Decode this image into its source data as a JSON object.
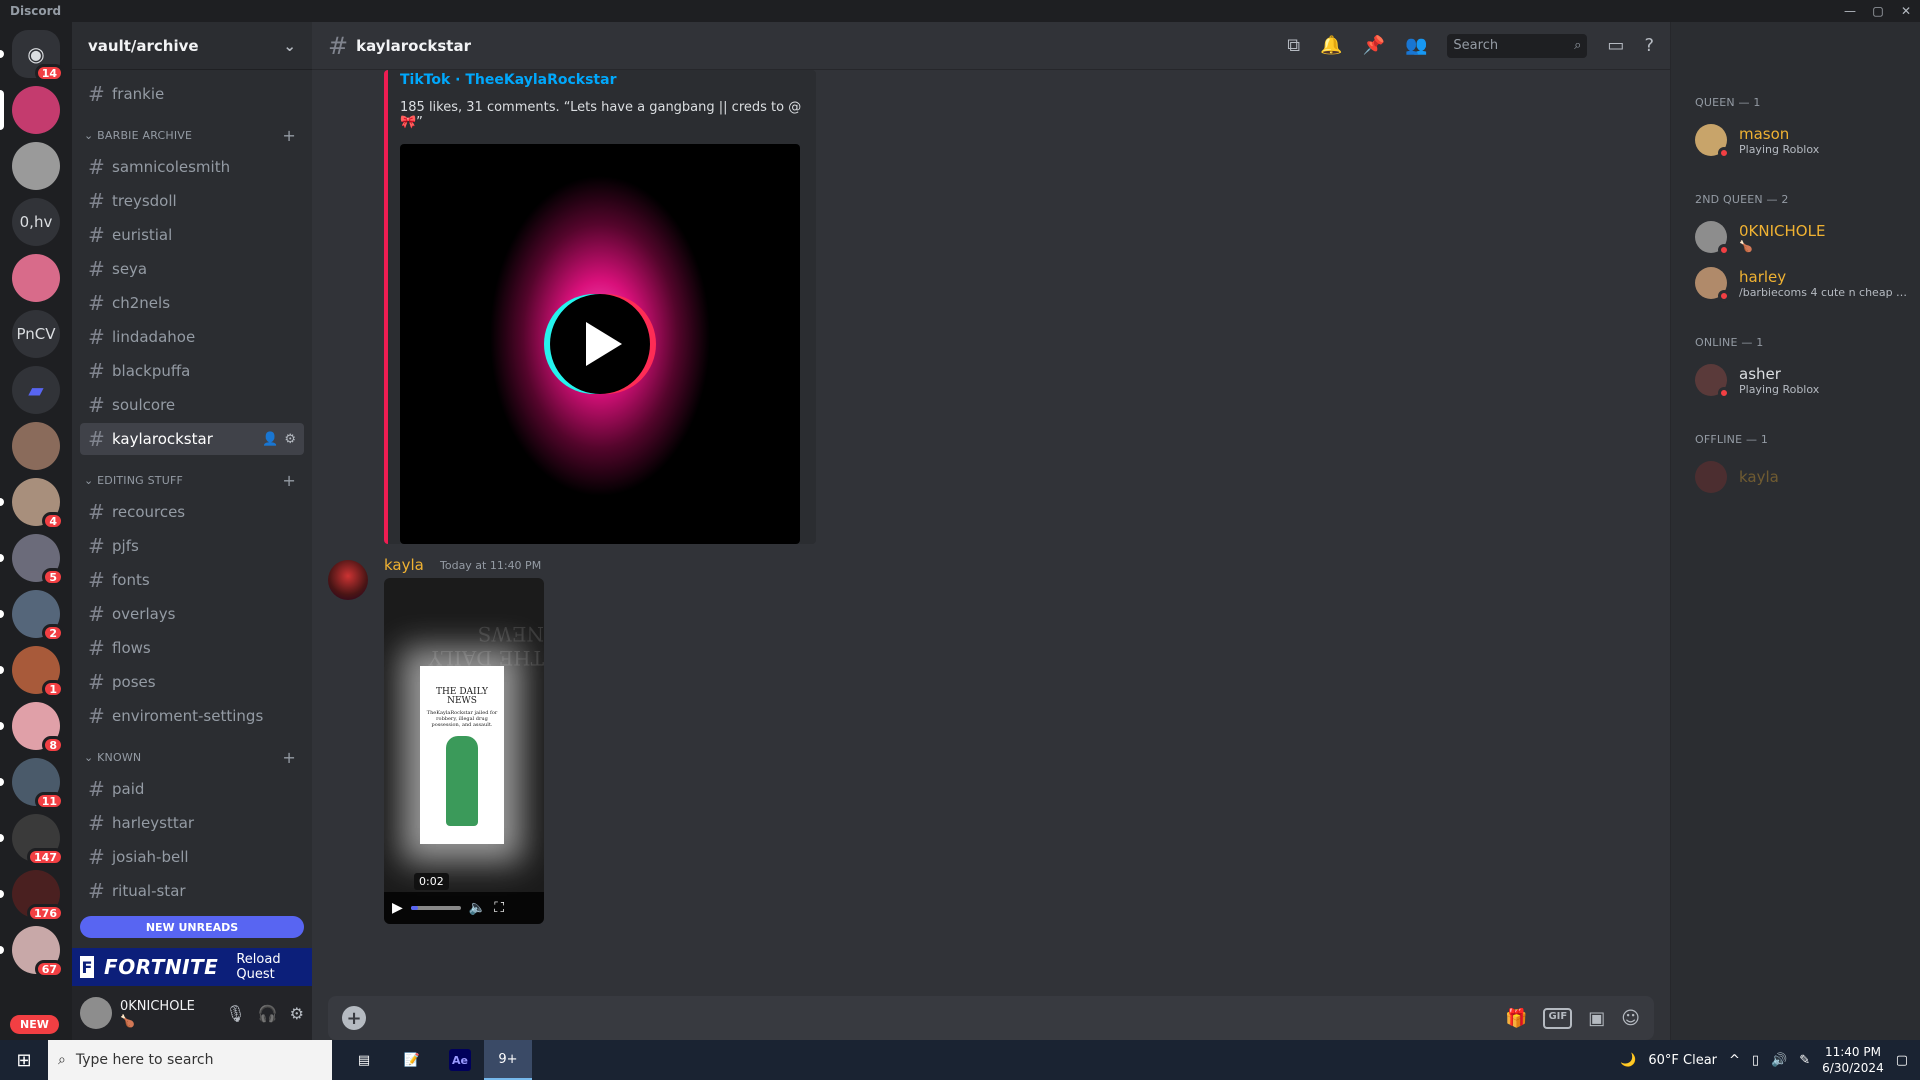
{
  "window": {
    "title": "Discord",
    "controls": [
      "—",
      "▢",
      "✕"
    ]
  },
  "guilds": [
    {
      "label": "",
      "icon": "discord-logo-icon",
      "badge": "14",
      "home": true
    },
    {
      "label": "",
      "badge": "",
      "color": "#c43b6e",
      "selected": true
    },
    {
      "label": "",
      "badge": "",
      "color": "#9a9a9a"
    },
    {
      "label": "0,hv",
      "badge": ""
    },
    {
      "label": "",
      "badge": "",
      "color": "#d86b8a"
    },
    {
      "label": "PnCV",
      "badge": ""
    },
    {
      "label": "",
      "icon": "folder-icon",
      "badge": ""
    },
    {
      "label": "",
      "badge": "",
      "color": "#8a6b5b"
    },
    {
      "label": "",
      "badge": "4",
      "color": "#a88f7c"
    },
    {
      "label": "",
      "badge": "5",
      "color": "#6b6b7a"
    },
    {
      "label": "",
      "badge": "2",
      "color": "#55667a"
    },
    {
      "label": "",
      "badge": "1",
      "color": "#a85a3a"
    },
    {
      "label": "",
      "badge": "8",
      "color": "#e0a0a8"
    },
    {
      "label": "",
      "badge": "11",
      "color": "#4a5a6a"
    },
    {
      "label": "",
      "badge": "147",
      "color": "#3a3a3a"
    },
    {
      "label": "",
      "badge": "176",
      "color": "#4a2020"
    },
    {
      "label": "",
      "badge": "67",
      "color": "#c8a8a8"
    }
  ],
  "guild_new_label": "NEW",
  "server": {
    "name": "vault/archive"
  },
  "channel_list": {
    "top_channels": [
      "frankie"
    ],
    "categories": [
      {
        "name": "BARBIE ARCHIVE",
        "channels": [
          "samnicolesmith",
          "treysdoll",
          "euristial",
          "seya",
          "ch2nels",
          "lindadahoe",
          "blackpuffa",
          "soulcore",
          "kaylarockstar"
        ]
      },
      {
        "name": "EDITING STUFF",
        "channels": [
          "recources",
          "pjfs",
          "fonts",
          "overlays",
          "flows",
          "poses",
          "enviroment-settings"
        ]
      },
      {
        "name": "KNOWN",
        "channels": [
          "paid",
          "harleysttar",
          "josiah-bell",
          "ritual-star"
        ]
      }
    ],
    "selected_channel": "kaylarockstar",
    "new_unreads_label": "NEW UNREADS"
  },
  "quest": {
    "brand_letter": "F",
    "brand_name": "FORTNITE",
    "label": "Reload Quest"
  },
  "user_panel": {
    "username": "0KNICHOLE",
    "status_emoji": "🍗"
  },
  "channel_header": {
    "name": "kaylarockstar",
    "search_placeholder": "Search"
  },
  "embed": {
    "provider": "TikTok · TheeKaylaRockstar",
    "description": "185 likes, 31 comments. “Lets have a gangbang || creds to @ 🎀”"
  },
  "message": {
    "author": "kayla",
    "timestamp": "Today at 11:40 PM",
    "video": {
      "headline_mirrored": "THE DAILY NEWS",
      "headline": "THE DAILY NEWS",
      "subtext": "TheKaylaRockstar jailed for robbery, illegal drug possession, and assault.",
      "time_tooltip": "0:02",
      "progress": 0.15
    }
  },
  "composer": {
    "gif_label": "GIF"
  },
  "members": {
    "groups": [
      {
        "title": "QUEEN — 1",
        "members": [
          {
            "name": "mason",
            "activity": "Playing Roblox",
            "name_color": "#f0b232",
            "avatar_color": "#c8a46a",
            "status": "dnd"
          }
        ]
      },
      {
        "title": "2ND QUEEN — 2",
        "members": [
          {
            "name": "0KNICHOLE",
            "activity": "🍗",
            "name_color": "#f0b232",
            "avatar_color": "#8d8d8d",
            "status": "dnd"
          },
          {
            "name": "harley",
            "activity": "/barbiecoms 4 cute n cheap e...",
            "name_color": "#f0b232",
            "avatar_color": "#b08a6a",
            "status": "dnd"
          }
        ]
      },
      {
        "title": "ONLINE — 1",
        "members": [
          {
            "name": "asher",
            "activity": "Playing Roblox",
            "name_color": "#dbdee1",
            "avatar_color": "#5a3a3a",
            "status": "dnd"
          }
        ]
      },
      {
        "title": "OFFLINE — 1",
        "members": [
          {
            "name": "kayla",
            "activity": "",
            "name_color": "#f0b232",
            "avatar_color": "#8a3030",
            "status": "offline"
          }
        ]
      }
    ]
  },
  "taskbar": {
    "search_placeholder": "Type here to search",
    "weather": "60°F  Clear",
    "time": "11:40 PM",
    "date": "6/30/2024",
    "discord_badge": "9+",
    "ae_label": "Ae"
  }
}
